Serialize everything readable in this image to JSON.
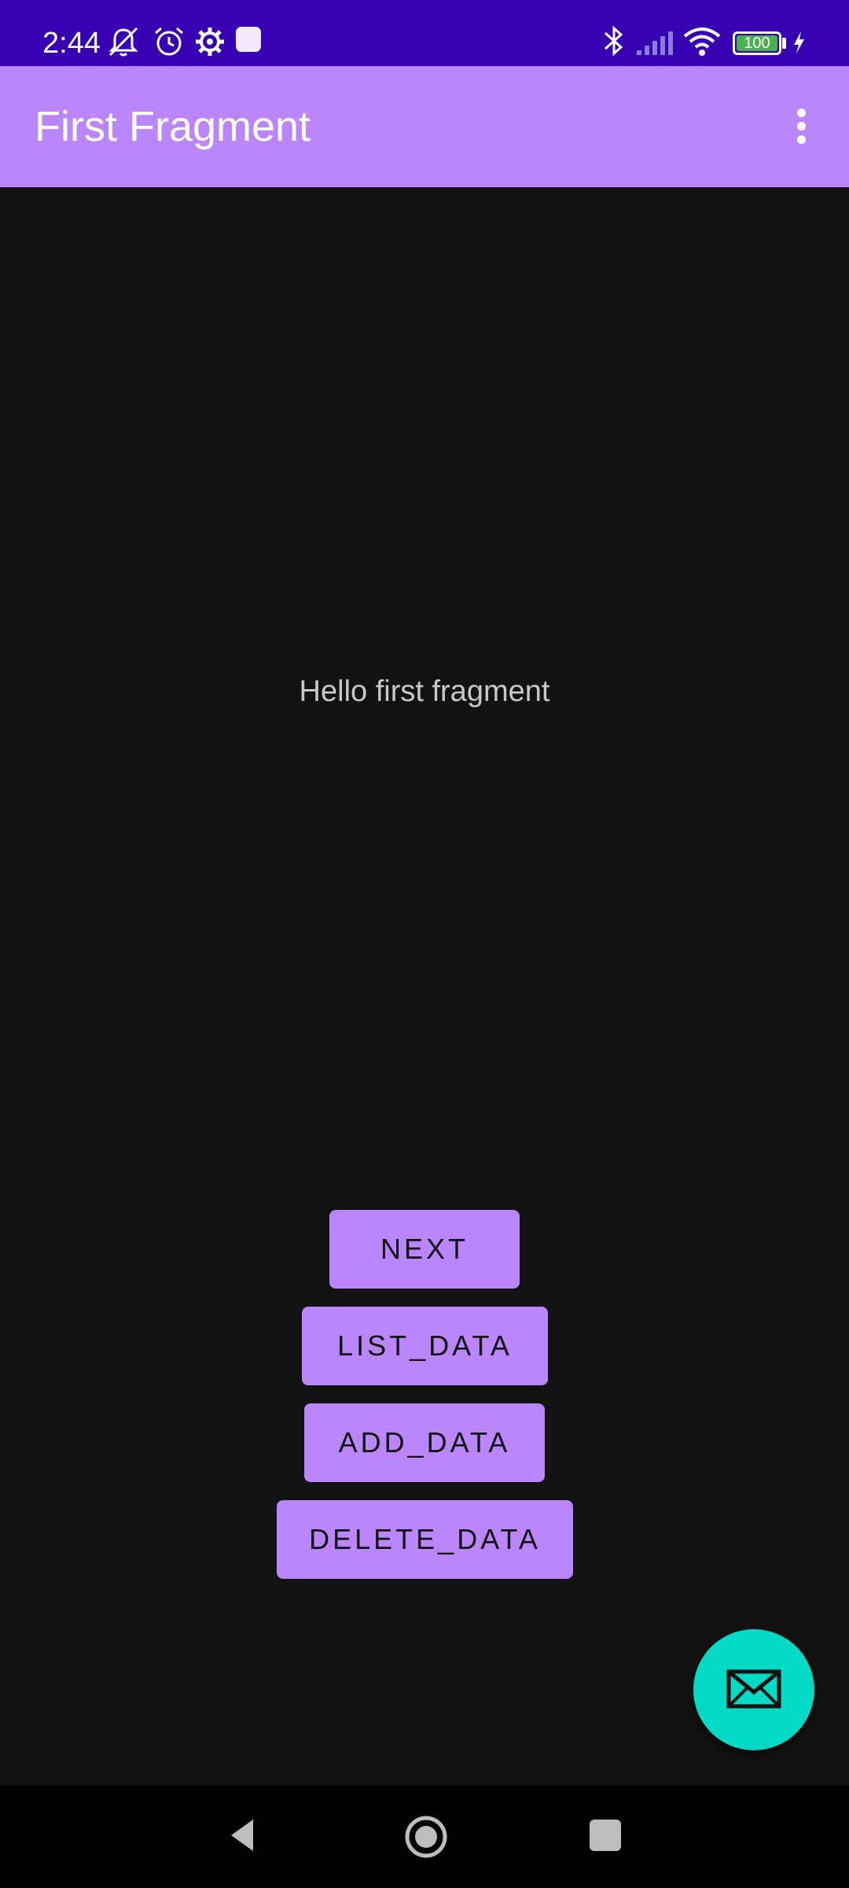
{
  "status_bar": {
    "time": "2:44",
    "battery_level": "100",
    "icons": [
      "notifications-off-icon",
      "alarm-icon",
      "settings-icon",
      "app-square-icon",
      "bluetooth-icon",
      "signal-icon",
      "wifi-icon",
      "battery-icon",
      "charging-icon"
    ]
  },
  "app_bar": {
    "title": "First Fragment",
    "overflow_icon": "more-vert-icon"
  },
  "content": {
    "hello_text": "Hello first fragment"
  },
  "buttons": {
    "next": "NEXT",
    "list_data": "LIST_DATA",
    "add_data": "ADD_DATA",
    "delete_data": "DELETE_DATA"
  },
  "fab": {
    "icon": "mail-icon"
  },
  "nav_bar": {
    "icons": [
      "back-icon",
      "home-icon",
      "recents-icon"
    ]
  },
  "colors": {
    "status_bar": "#3700b3",
    "app_bar": "#bb86fc",
    "background": "#121212",
    "button": "#bb86fc",
    "fab": "#03dac5",
    "nav_bar": "#000000"
  }
}
